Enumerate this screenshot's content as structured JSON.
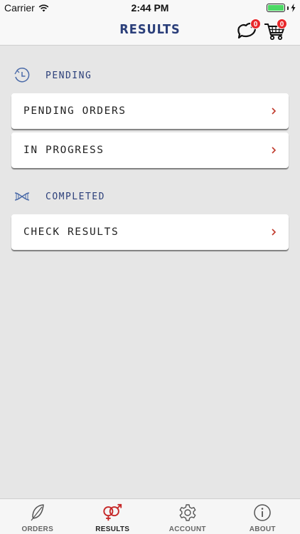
{
  "status_bar": {
    "carrier": "Carrier",
    "time": "2:44 PM"
  },
  "header": {
    "title": "RESULTS",
    "messages_count": "0",
    "cart_count": "0"
  },
  "sections": {
    "pending": {
      "label": "PENDING",
      "items": [
        "PENDING ORDERS",
        "IN PROGRESS"
      ]
    },
    "completed": {
      "label": "COMPLETED",
      "items": [
        "CHECK RESULTS"
      ]
    }
  },
  "tabs": [
    {
      "label": "ORDERS",
      "icon": "feather-icon",
      "active": false
    },
    {
      "label": "RESULTS",
      "icon": "gender-icon",
      "active": true
    },
    {
      "label": "ACCOUNT",
      "icon": "gear-icon",
      "active": false
    },
    {
      "label": "ABOUT",
      "icon": "info-icon",
      "active": false
    }
  ],
  "colors": {
    "accent": "#2b3f7a",
    "badge": "#e8282b",
    "chevron": "#c0392b",
    "active_tab": "#c62828"
  }
}
